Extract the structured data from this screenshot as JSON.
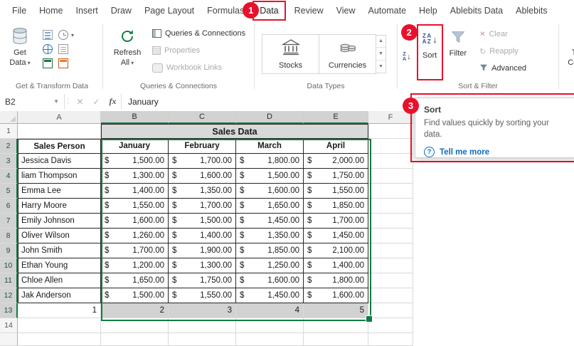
{
  "colors": {
    "accent_green": "#107C41",
    "annotation_red": "#E8112D",
    "link_blue": "#0F6CBD",
    "table_header_fill": "#D9D9D9",
    "selection_fill": "#D2D2D2"
  },
  "callouts": {
    "step1": "1",
    "step2": "2",
    "step3": "3"
  },
  "tabs": {
    "items": [
      {
        "label": "File"
      },
      {
        "label": "Home"
      },
      {
        "label": "Insert"
      },
      {
        "label": "Draw"
      },
      {
        "label": "Page Layout"
      },
      {
        "label": "Formulas"
      },
      {
        "label": "Data"
      },
      {
        "label": "Review"
      },
      {
        "label": "View"
      },
      {
        "label": "Automate"
      },
      {
        "label": "Help"
      },
      {
        "label": "Ablebits Data"
      },
      {
        "label": "Ablebits"
      }
    ]
  },
  "ribbon": {
    "get_transform": {
      "group_label": "Get & Transform Data",
      "get_data_label": "Get Data"
    },
    "queries": {
      "group_label": "Queries & Connections",
      "refresh_all_label": "Refresh All",
      "queries_connections_label": "Queries & Connections",
      "properties_label": "Properties",
      "workbook_links_label": "Workbook Links"
    },
    "data_types": {
      "group_label": "Data Types",
      "stocks_label": "Stocks",
      "currencies_label": "Currencies"
    },
    "sort_filter": {
      "group_label": "Sort & Filter",
      "sort_label": "Sort",
      "filter_label": "Filter",
      "clear_label": "Clear",
      "reapply_label": "Reapply",
      "advanced_label": "Advanced"
    },
    "text_to_columns_label": "Text to Columns"
  },
  "formula_bar": {
    "name_box": "B2",
    "fx_label": "fx",
    "value": "January"
  },
  "tooltip": {
    "title": "Sort",
    "body": "Find values quickly by sorting your data.",
    "link": "Tell me more"
  },
  "grid": {
    "columns": [
      "A",
      "B",
      "C",
      "D",
      "E",
      "F"
    ],
    "visible_rows": 14,
    "selection": {
      "active_cell": "B2",
      "columns": [
        "B",
        "C",
        "D",
        "E"
      ],
      "row_start": 2,
      "row_end": 13
    },
    "table": {
      "title": "Sales Data",
      "currency_symbol": "$",
      "headers": [
        "Sales Person",
        "January",
        "February",
        "March",
        "April"
      ],
      "rows": [
        {
          "name": "Jessica Davis",
          "values": [
            "1,500.00",
            "1,700.00",
            "1,800.00",
            "2,000.00"
          ]
        },
        {
          "name": "liam Thompson",
          "values": [
            "1,300.00",
            "1,600.00",
            "1,500.00",
            "1,750.00"
          ]
        },
        {
          "name": "Emma Lee",
          "values": [
            "1,400.00",
            "1,350.00",
            "1,600.00",
            "1,550.00"
          ]
        },
        {
          "name": "Harry Moore",
          "values": [
            "1,550.00",
            "1,700.00",
            "1,650.00",
            "1,850.00"
          ]
        },
        {
          "name": "Emily Johnson",
          "values": [
            "1,600.00",
            "1,500.00",
            "1,450.00",
            "1,700.00"
          ]
        },
        {
          "name": "Oliver Wilson",
          "values": [
            "1,260.00",
            "1,400.00",
            "1,350.00",
            "1,450.00"
          ]
        },
        {
          "name": "John Smith",
          "values": [
            "1,700.00",
            "1,900.00",
            "1,850.00",
            "2,100.00"
          ]
        },
        {
          "name": "Ethan Young",
          "values": [
            "1,200.00",
            "1,300.00",
            "1,250.00",
            "1,400.00"
          ]
        },
        {
          "name": "Chloe Allen",
          "values": [
            "1,650.00",
            "1,750.00",
            "1,600.00",
            "1,800.00"
          ]
        },
        {
          "name": "Jak Anderson",
          "values": [
            "1,500.00",
            "1,550.00",
            "1,450.00",
            "1,600.00"
          ]
        }
      ],
      "footer_row": {
        "a": "1",
        "values": [
          "2",
          "3",
          "4",
          "5"
        ]
      }
    }
  }
}
